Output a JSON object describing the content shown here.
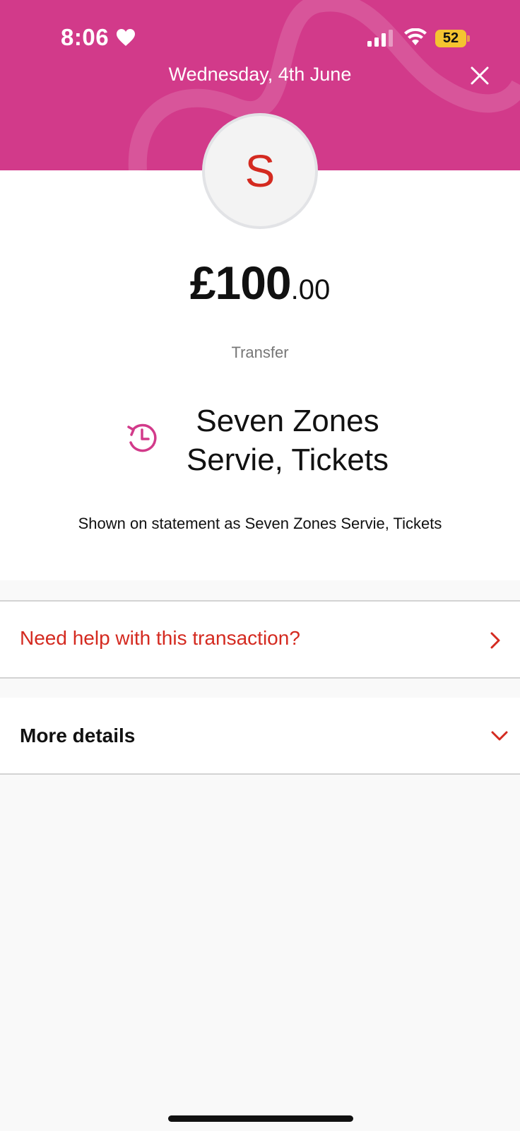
{
  "status_bar": {
    "time": "8:06",
    "battery_level": "52"
  },
  "header": {
    "date": "Wednesday, 4th June",
    "background_color": "#d23a8a"
  },
  "avatar": {
    "initial": "S"
  },
  "transaction": {
    "amount_major": "£100",
    "amount_minor": ".00",
    "type": "Transfer",
    "merchant_line1": "Seven Zones",
    "merchant_line2": "Servie, Tickets",
    "statement_text": "Shown on statement as Seven Zones Servie,  Tickets"
  },
  "rows": {
    "help_label": "Need help with this transaction?",
    "details_label": "More details"
  },
  "colors": {
    "accent_red": "#d42a20",
    "brand_pink": "#d23a8a"
  },
  "icons": [
    "heart-icon",
    "signal-icon",
    "wifi-icon",
    "battery-icon",
    "close-icon",
    "recurring-payment-icon",
    "chevron-right-icon",
    "chevron-down-icon"
  ]
}
